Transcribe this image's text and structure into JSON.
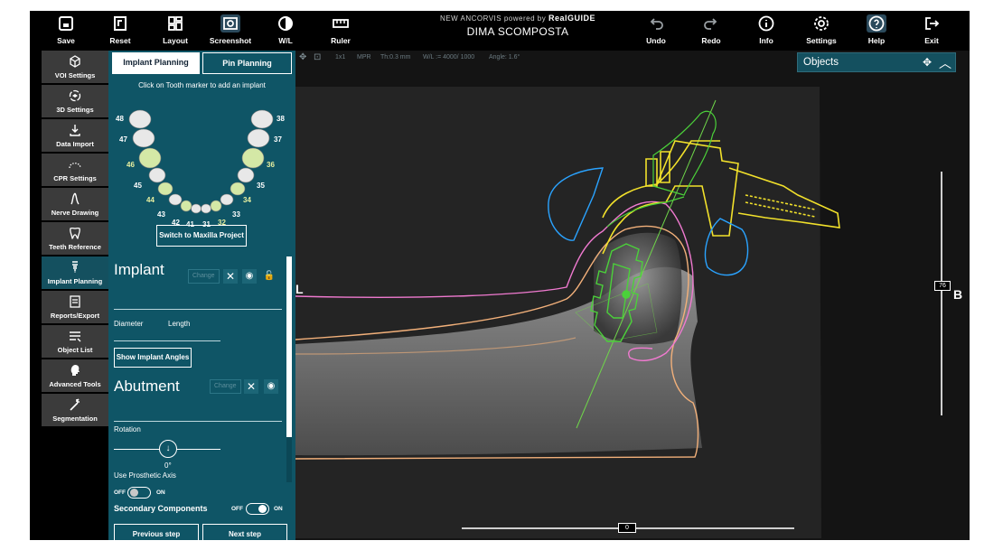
{
  "toolbar": {
    "save": "Save",
    "reset": "Reset",
    "layout": "Layout",
    "screenshot": "Screenshot",
    "wl": "W/L",
    "ruler": "Ruler",
    "undo": "Undo",
    "redo": "Redo",
    "info": "Info",
    "settings": "Settings",
    "help": "Help",
    "exit": "Exit"
  },
  "brand": {
    "prefix": "NEW ANCORVIS",
    "powered": "powered by",
    "product": "RealGUIDE",
    "patient": "DIMA SCOMPOSTA"
  },
  "leftnav": [
    {
      "label": "VOI Settings",
      "icon": "cube-icon"
    },
    {
      "label": "3D Settings",
      "icon": "rotate-3d-icon"
    },
    {
      "label": "Data Import",
      "icon": "download-icon"
    },
    {
      "label": "CPR Settings",
      "icon": "arch-icon"
    },
    {
      "label": "Nerve Drawing",
      "icon": "nerve-icon"
    },
    {
      "label": "Teeth Reference",
      "icon": "tooth-icon"
    },
    {
      "label": "Implant Planning",
      "icon": "implant-icon"
    },
    {
      "label": "Reports/Export",
      "icon": "report-icon"
    },
    {
      "label": "Object List",
      "icon": "list-icon"
    },
    {
      "label": "Advanced Tools",
      "icon": "head-icon"
    },
    {
      "label": "Segmentation",
      "icon": "wand-icon"
    }
  ],
  "panel": {
    "tab_implant": "Implant Planning",
    "tab_pin": "Pin Planning",
    "hint": "Click on Tooth marker to add an implant",
    "teeth": [
      "48",
      "47",
      "46",
      "45",
      "44",
      "43",
      "42",
      "41",
      "31",
      "32",
      "33",
      "34",
      "35",
      "36",
      "37",
      "38"
    ],
    "switch_label": "Switch to Maxilla Project",
    "implant_title": "Implant",
    "change_label": "Change",
    "diameter_label": "Diameter",
    "length_label": "Length",
    "angles_button": "Show Implant Angles",
    "abutment_title": "Abutment",
    "rotation_label": "Rotation",
    "rotation_value": "0°",
    "prosthetic_label": "Use Prosthetic Axis",
    "off_label": "OFF",
    "on_label": "ON",
    "secondary_label": "Secondary Components",
    "prev_label": "Previous step",
    "next_label": "Next step"
  },
  "viewport": {
    "layout": "1x1",
    "mode": "MPR",
    "thickness": "Th:0.3 mm",
    "wl": "W/L := 4000/ 1000",
    "angle": "Angle: 1.6°",
    "left_label": "L",
    "right_label": "B",
    "objects_title": "Objects",
    "slice_value": "76",
    "rotation_value": "0"
  },
  "colors": {
    "panel": "#0f5566",
    "active_nav": "#14505f",
    "implant": "#4bd13a",
    "guide": "#f2e12b",
    "pin": "#2aa3ff",
    "gum": "#f07ad0",
    "bone": "#f2b07a",
    "axis": "#6fd64a"
  }
}
